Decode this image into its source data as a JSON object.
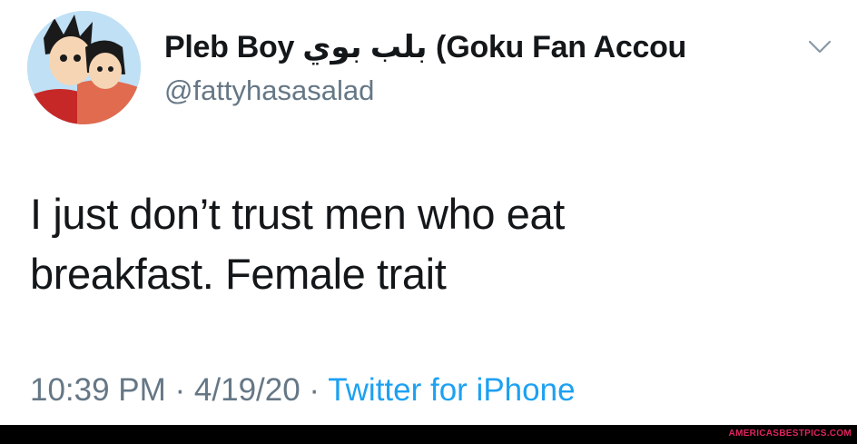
{
  "tweet": {
    "display_name": "Pleb Boy بلب بوي (Goku Fan Accou",
    "handle": "@fattyhasasalad",
    "text_lines": [
      "I just don’t trust men who eat",
      "breakfast. Female trait"
    ],
    "time": "10:39 PM",
    "separator": " · ",
    "date": "4/19/20",
    "source": "Twitter for iPhone",
    "colors": {
      "text": "#14171a",
      "muted": "#657786",
      "link": "#1da1f2"
    }
  },
  "watermark": {
    "text": "AMERICASBESTPICS.COM",
    "color": "#e0245e"
  },
  "icons": {
    "menu": "chevron-down-icon",
    "profile": "avatar"
  }
}
